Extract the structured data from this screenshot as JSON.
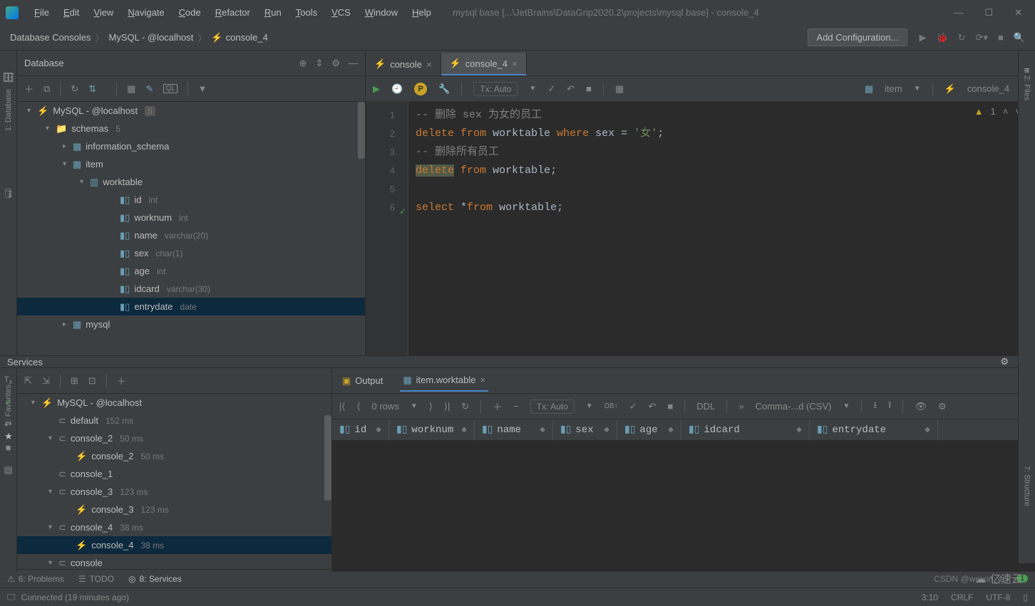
{
  "titlebar": {
    "menus": [
      "File",
      "Edit",
      "View",
      "Navigate",
      "Code",
      "Refactor",
      "Run",
      "Tools",
      "VCS",
      "Window",
      "Help"
    ],
    "path": "mysql base [...\\JetBrains\\DataGrip2020.2\\projects\\mysql base] - console_4"
  },
  "breadcrumb": [
    "Database Consoles",
    "MySQL - @localhost",
    "console_4"
  ],
  "config_btn": "Add Configuration...",
  "database_panel": {
    "title": "Database",
    "connection_label": "MySQL - @localhost",
    "connection_badge": "5",
    "schemas_label": "schemas",
    "schemas_count": "5",
    "schema1": "information_schema",
    "schema2": "item",
    "table": "worktable",
    "cols": [
      {
        "n": "id",
        "t": "int"
      },
      {
        "n": "worknum",
        "t": "int"
      },
      {
        "n": "name",
        "t": "varchar(20)"
      },
      {
        "n": "sex",
        "t": "char(1)"
      },
      {
        "n": "age",
        "t": "int"
      },
      {
        "n": "idcard",
        "t": "varchar(30)"
      },
      {
        "n": "entrydate",
        "t": "date"
      }
    ],
    "schema3": "mysql"
  },
  "editor": {
    "tabs": [
      {
        "label": "console",
        "active": false
      },
      {
        "label": "console_4",
        "active": true
      }
    ],
    "tx_mode": "Tx: Auto",
    "context_schema": "item",
    "context_console": "console_4",
    "warning_count": "1",
    "lines": [
      {
        "n": 1,
        "html": "<span class='cm-comment'>-- 删除 sex 为女的员工</span>"
      },
      {
        "n": 2,
        "html": "<span class='cm-keyword'>delete</span> <span class='cm-keyword'>from</span> <span class='cm-ident'>worktable</span> <span class='cm-keyword'>where</span> <span class='cm-ident'>sex</span> <span class='cm-ident'>=</span> <span class='cm-string'>'女'</span><span class='cm-ident'>;</span>"
      },
      {
        "n": 3,
        "html": "<span class='cm-comment'>-- 删除所有员工</span>"
      },
      {
        "n": 4,
        "html": "<span class='cm-keyword cm-hl'>delete</span> <span class='cm-keyword'>from</span> <span class='cm-ident'>worktable</span><span class='cm-ident'>;</span>"
      },
      {
        "n": 5,
        "html": ""
      },
      {
        "n": 6,
        "html": "<span class='cm-keyword'>select</span> <span class='cm-ident'>*</span><span class='cm-keyword'>from</span> <span class='cm-ident'>worktable</span><span class='cm-ident'>;</span>",
        "check": true
      }
    ]
  },
  "services": {
    "title": "Services",
    "tree": [
      {
        "indent": 20,
        "arrow": "▾",
        "icon": "plug",
        "label": "MySQL - @localhost",
        "meta": ""
      },
      {
        "indent": 44,
        "arrow": "",
        "icon": "c",
        "label": "default",
        "meta": "152 ms"
      },
      {
        "indent": 44,
        "arrow": "▾",
        "icon": "c",
        "label": "console_2",
        "meta": "50 ms"
      },
      {
        "indent": 68,
        "arrow": "",
        "icon": "plug",
        "label": "console_2",
        "meta": "50 ms"
      },
      {
        "indent": 44,
        "arrow": "",
        "icon": "c",
        "label": "console_1",
        "meta": ""
      },
      {
        "indent": 44,
        "arrow": "▾",
        "icon": "c",
        "label": "console_3",
        "meta": "123 ms"
      },
      {
        "indent": 68,
        "arrow": "",
        "icon": "plug",
        "label": "console_3",
        "meta": "123 ms"
      },
      {
        "indent": 44,
        "arrow": "▾",
        "icon": "c",
        "label": "console_4",
        "meta": "38 ms"
      },
      {
        "indent": 68,
        "arrow": "",
        "icon": "plug",
        "label": "console_4",
        "meta": "38 ms",
        "sel": true
      },
      {
        "indent": 44,
        "arrow": "▾",
        "icon": "c",
        "label": "console",
        "meta": ""
      }
    ],
    "output_tab": "Output",
    "result_tab": "item.worktable",
    "rows_label": "0 rows",
    "tx_mode": "Tx: Auto",
    "ddl": "DDL",
    "export": "Comma-...d (CSV)",
    "columns": [
      "id",
      "worknum",
      "name",
      "sex",
      "age",
      "idcard",
      "entrydate"
    ]
  },
  "bottombar": {
    "problems": "6: Problems",
    "todo": "TODO",
    "services": "8: Services"
  },
  "statusbar": {
    "msg": "Connected (19 minutes ago)",
    "pos": "3:10",
    "crlf": "CRLF",
    "enc": "UTF-8",
    "csdn": "CSDN @weixin_4",
    "brand": "亿速云"
  },
  "right": {
    "files": "2: Files",
    "structure": "7: Structure"
  },
  "left": {
    "database": "1: Database",
    "favorites": "2: Favorites"
  }
}
